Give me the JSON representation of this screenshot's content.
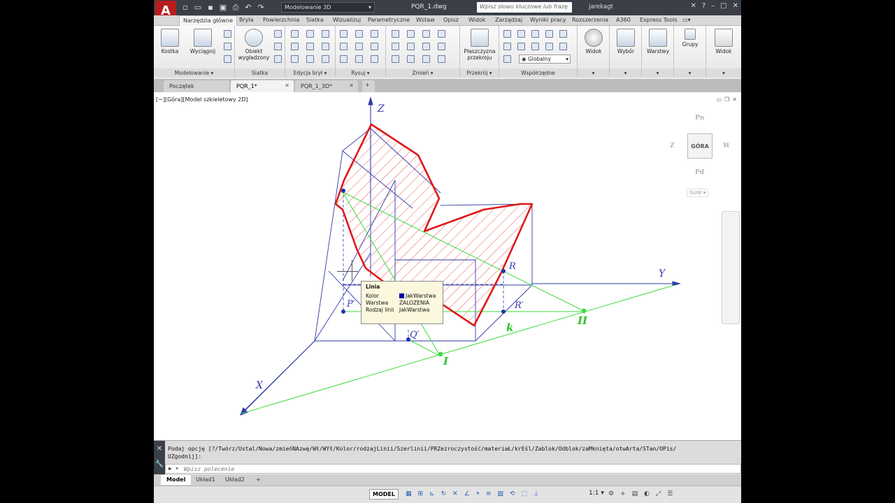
{
  "app": {
    "logo_letter": "A",
    "workspace": "Modelowanie 3D",
    "title": "PQR_1.dwg",
    "search_placeholder": "Wpisz słowo kluczowe lub frazę",
    "user": "jarekagt"
  },
  "ribbon_tabs": [
    "Narzędzia główne",
    "Bryła",
    "Powierzchnia",
    "Siatka",
    "Wizualizuj",
    "Parametryczne",
    "Wstaw",
    "Opisz",
    "Widok",
    "Zarządzaj",
    "Wyniki pracy",
    "Rozszerzenia",
    "A360",
    "Express Tools"
  ],
  "ribbon": {
    "kostka": "Kostka",
    "wyciagnij": "Wyciągnij",
    "obiekt_wygladzony_1": "Obiekt",
    "obiekt_wygladzony_2": "wygładzony",
    "plaszczyzna_1": "Płaszczyzna",
    "plaszczyzna_2": "przekroju",
    "globalny": "Globalny",
    "widok": "Widok",
    "wybor": "Wybór",
    "warstwy": "Warstwy",
    "grupy": "Grupy",
    "widok2": "Widok",
    "groups": {
      "modelowanie": "Modelowanie ▾",
      "siatka": "Siatka",
      "edycja_bryl": "Edycja brył ▾",
      "rysuj": "Rysuj ▾",
      "zmien": "Zmień ▾",
      "przekroj": "Przekrój ▾",
      "wspolrzedne": "Współrzędne"
    }
  },
  "doc_tabs": [
    "Początek",
    "PQR_1*",
    "PQR_1_3D*"
  ],
  "viewport": {
    "label": "[−][Góra][Model szkieletowy 2D]"
  },
  "navcube": {
    "top": "GÓRA",
    "n": "Pn",
    "s": "Pd",
    "w": "Z",
    "e": "W",
    "ucs": "GUW ▾"
  },
  "drawing_labels": {
    "z": "Z",
    "y": "Y",
    "x": "X",
    "r": "R",
    "r_prime": "R′",
    "p_prime": "P′",
    "q_prime": "Q′",
    "k": "k",
    "i": "I",
    "ii": "II"
  },
  "tooltip": {
    "title": "Linia",
    "rows": [
      {
        "k": "Kolor",
        "v": "JakWarstwa"
      },
      {
        "k": "Warstwa",
        "v": "ZALOZENIA"
      },
      {
        "k": "Rodzaj linii",
        "v": "JakWarstwa"
      }
    ]
  },
  "command": {
    "history": "Podaj opcję [?/Twórz/Ustal/Nowa/zmieńNAzwę/Wł/WYł/Kolor/rodzajLinii/Szerlinii/PRZezroczystość/materiaŁ/krEśl/Zablok/Odblok/zaMknięta/otwArta/STan/OPis/\nUZgodnij]:",
    "placeholder": "Wpisz polecenie",
    "prompt": "▶ ▾"
  },
  "layout_tabs": [
    "Model",
    "Układ1",
    "Układ2",
    "+"
  ],
  "status": {
    "model": "MODEL",
    "scale": "1:1 ▾"
  },
  "colors": {
    "axis": "#2f3aa8",
    "section": "#e01818",
    "trace": "#3ddc3d",
    "hatch": "#e43030"
  }
}
